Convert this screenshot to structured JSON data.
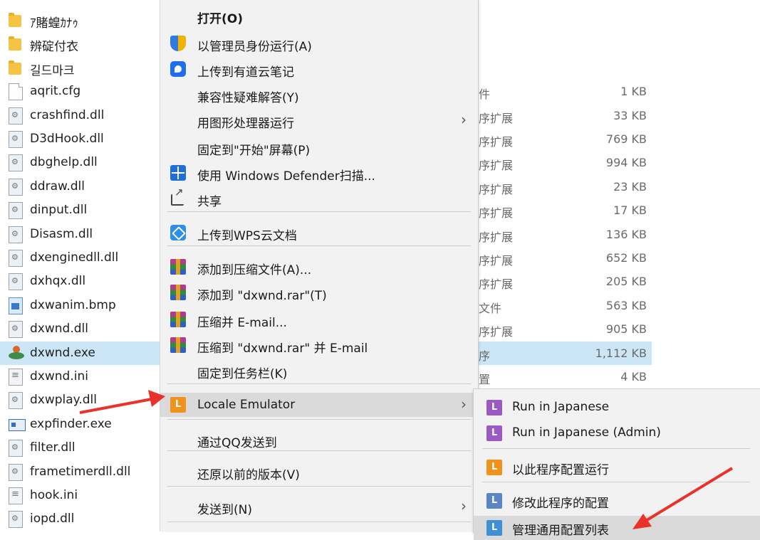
{
  "files": [
    {
      "name": "ｱ賭蝗ｶﾅｩ",
      "icon": "folder-icon",
      "type": "",
      "size": ""
    },
    {
      "name": "辨碇付衣",
      "icon": "folder-icon",
      "type": "",
      "size": ""
    },
    {
      "name": "길드마크",
      "icon": "folder-icon",
      "type": "",
      "size": ""
    },
    {
      "name": "aqrit.cfg",
      "icon": "doc-icon",
      "type": "件",
      "size": "1 KB"
    },
    {
      "name": "crashfind.dll",
      "icon": "dll-icon",
      "type": "序扩展",
      "size": "33 KB"
    },
    {
      "name": "D3dHook.dll",
      "icon": "dll-icon",
      "type": "序扩展",
      "size": "769 KB"
    },
    {
      "name": "dbghelp.dll",
      "icon": "dll-icon",
      "type": "序扩展",
      "size": "994 KB"
    },
    {
      "name": "ddraw.dll",
      "icon": "dll-icon",
      "type": "序扩展",
      "size": "23 KB"
    },
    {
      "name": "dinput.dll",
      "icon": "dll-icon",
      "type": "序扩展",
      "size": "17 KB"
    },
    {
      "name": "Disasm.dll",
      "icon": "dll-icon",
      "type": "序扩展",
      "size": "136 KB"
    },
    {
      "name": "dxenginedll.dll",
      "icon": "dll-icon",
      "type": "序扩展",
      "size": "652 KB"
    },
    {
      "name": "dxhqx.dll",
      "icon": "dll-icon",
      "type": "序扩展",
      "size": "205 KB"
    },
    {
      "name": "dxwanim.bmp",
      "icon": "bmp-icon",
      "type": "文件",
      "size": "563 KB"
    },
    {
      "name": "dxwnd.dll",
      "icon": "dll-icon",
      "type": "序扩展",
      "size": "905 KB"
    },
    {
      "name": "dxwnd.exe",
      "icon": "exe-icon",
      "type": "序",
      "size": "1,112 KB"
    },
    {
      "name": "dxwnd.ini",
      "icon": "ini-icon",
      "type": "置",
      "size": "4 KB"
    },
    {
      "name": "dxwplay.dll",
      "icon": "dll-icon",
      "type": "",
      "size": ""
    },
    {
      "name": "expfinder.exe",
      "icon": "exe2-icon",
      "type": "",
      "size": ""
    },
    {
      "name": "filter.dll",
      "icon": "dll-icon",
      "type": "",
      "size": ""
    },
    {
      "name": "frametimerdll.dll",
      "icon": "dll-icon",
      "type": "",
      "size": ""
    },
    {
      "name": "hook.ini",
      "icon": "ini-icon",
      "type": "",
      "size": ""
    },
    {
      "name": "iopd.dll",
      "icon": "dll-icon",
      "type": "",
      "size": ""
    }
  ],
  "selected_file_index": 14,
  "context_menu": {
    "items": [
      {
        "label": "打开(O)",
        "bold": true,
        "icon": "",
        "arrow": false
      },
      {
        "label": "以管理员身份运行(A)",
        "icon": "uac-shield-icon",
        "arrow": false
      },
      {
        "label": "上传到有道云笔记",
        "icon": "youdao-note-icon",
        "arrow": false
      },
      {
        "label": "兼容性疑难解答(Y)",
        "icon": "",
        "arrow": false
      },
      {
        "label": "用图形处理器运行",
        "icon": "",
        "arrow": true
      },
      {
        "label": "固定到\"开始\"屏幕(P)",
        "icon": "",
        "arrow": false
      },
      {
        "label": "使用 Windows Defender扫描...",
        "icon": "defender-icon",
        "arrow": false
      },
      {
        "label": "共享",
        "icon": "share-icon",
        "arrow": false
      },
      {
        "label": "上传到WPS云文档",
        "icon": "wps-cloud-icon",
        "arrow": false
      },
      {
        "label": "添加到压缩文件(A)...",
        "icon": "winrar-icon",
        "arrow": false
      },
      {
        "label": "添加到 \"dxwnd.rar\"(T)",
        "icon": "winrar-icon",
        "arrow": false
      },
      {
        "label": "压缩并 E-mail...",
        "icon": "winrar-icon",
        "arrow": false
      },
      {
        "label": "压缩到 \"dxwnd.rar\" 并 E-mail",
        "icon": "winrar-icon",
        "arrow": false
      },
      {
        "label": "固定到任务栏(K)",
        "icon": "",
        "arrow": false
      },
      {
        "label": "Locale Emulator",
        "icon": "locale-emulator-icon",
        "arrow": true
      },
      {
        "label": "通过QQ发送到",
        "icon": "",
        "arrow": false
      },
      {
        "label": "还原以前的版本(V)",
        "icon": "",
        "arrow": false
      },
      {
        "label": "发送到(N)",
        "icon": "",
        "arrow": true
      }
    ],
    "hovered": "Locale Emulator"
  },
  "submenu": {
    "items": [
      {
        "label": "Run in Japanese",
        "color": "#9b59c4",
        "letter": "L"
      },
      {
        "label": "Run in Japanese (Admin)",
        "color": "#9b59c4",
        "letter": "L"
      },
      {
        "label": "以此程序配置运行",
        "color": "#f0931e",
        "letter": "L"
      },
      {
        "label": "修改此程序的配置",
        "color": "#5b86c6",
        "letter": "L"
      },
      {
        "label": "管理通用配置列表",
        "color": "#3f8fd6",
        "letter": "L"
      }
    ]
  },
  "annotation_color": "#e8322a"
}
